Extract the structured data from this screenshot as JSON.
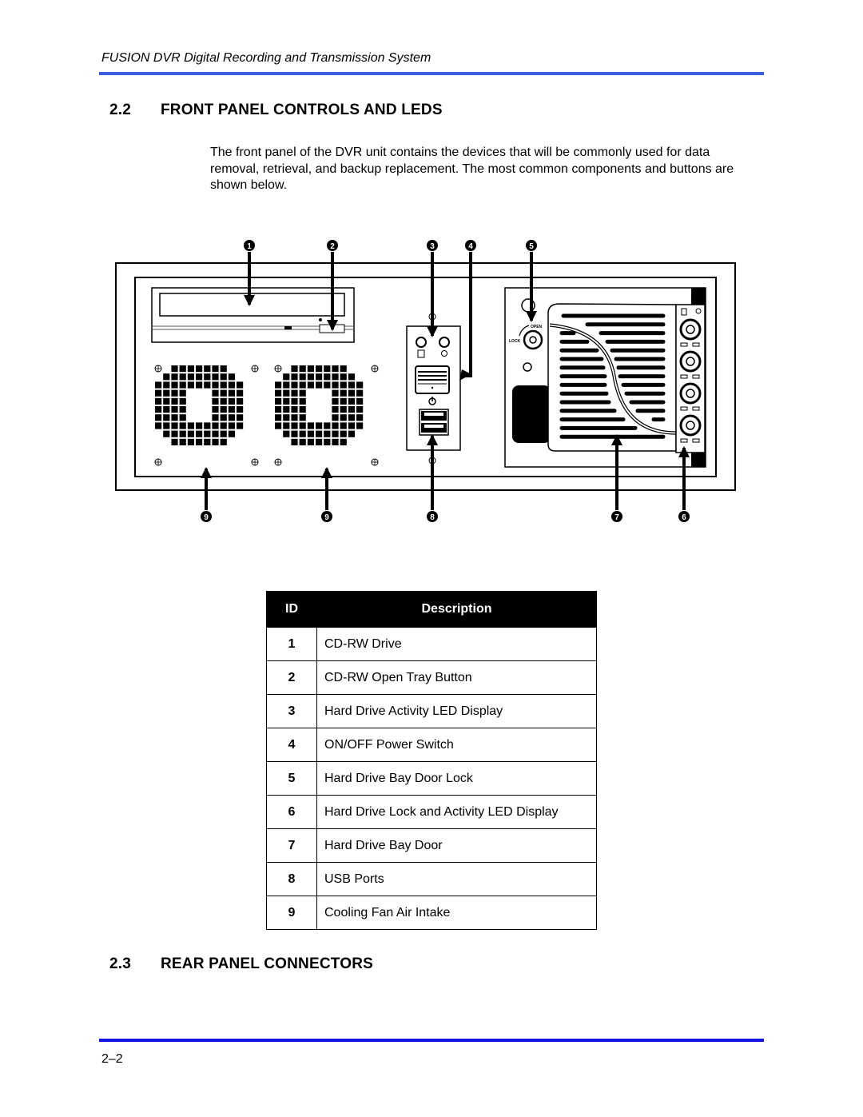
{
  "header": {
    "title": "FUSION DVR Digital Recording and Transmission System",
    "rule_color": "#3a5fe0"
  },
  "sections": [
    {
      "number": "2.2",
      "title": "FRONT PANEL CONTROLS AND LEDS"
    },
    {
      "number": "2.3",
      "title": "REAR PANEL CONNECTORS"
    }
  ],
  "intro": "The front panel of the DVR unit contains the devices that will be commonly used for data removal, retrieval, and backup replacement. The most common components and buttons are shown below.",
  "diagram": {
    "callouts_top": [
      "1",
      "2",
      "3",
      "4",
      "5"
    ],
    "callouts_bottom": [
      "9",
      "9",
      "8",
      "7",
      "6"
    ],
    "labels": {
      "open": "OPEN",
      "lock": "LOCK"
    }
  },
  "table": {
    "headers": {
      "id": "ID",
      "description": "Description"
    },
    "rows": [
      {
        "id": "1",
        "description": "CD-RW Drive"
      },
      {
        "id": "2",
        "description": "CD-RW Open Tray Button"
      },
      {
        "id": "3",
        "description": "Hard Drive Activity LED Display"
      },
      {
        "id": "4",
        "description": "ON/OFF Power Switch"
      },
      {
        "id": "5",
        "description": "Hard Drive Bay Door Lock"
      },
      {
        "id": "6",
        "description": "Hard Drive Lock and Activity LED Display"
      },
      {
        "id": "7",
        "description": "Hard Drive Bay Door"
      },
      {
        "id": "8",
        "description": "USB Ports"
      },
      {
        "id": "9",
        "description": "Cooling Fan Air Intake"
      }
    ]
  },
  "footer": {
    "page_number": "2–2",
    "rule_color": "#1414e6"
  }
}
